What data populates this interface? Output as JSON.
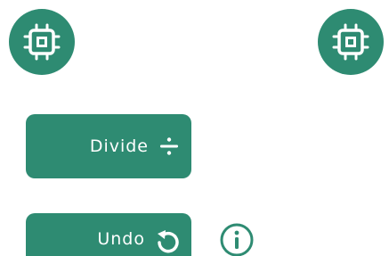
{
  "colors": {
    "accent": "#2e8b72",
    "on_accent": "#ffffff"
  },
  "icons": {
    "top_left": "chip-icon",
    "top_right": "chip-icon",
    "divide": "divide-icon",
    "undo": "undo-icon",
    "info": "info-icon"
  },
  "buttons": {
    "divide_label": "Divide",
    "undo_label": "Undo"
  }
}
